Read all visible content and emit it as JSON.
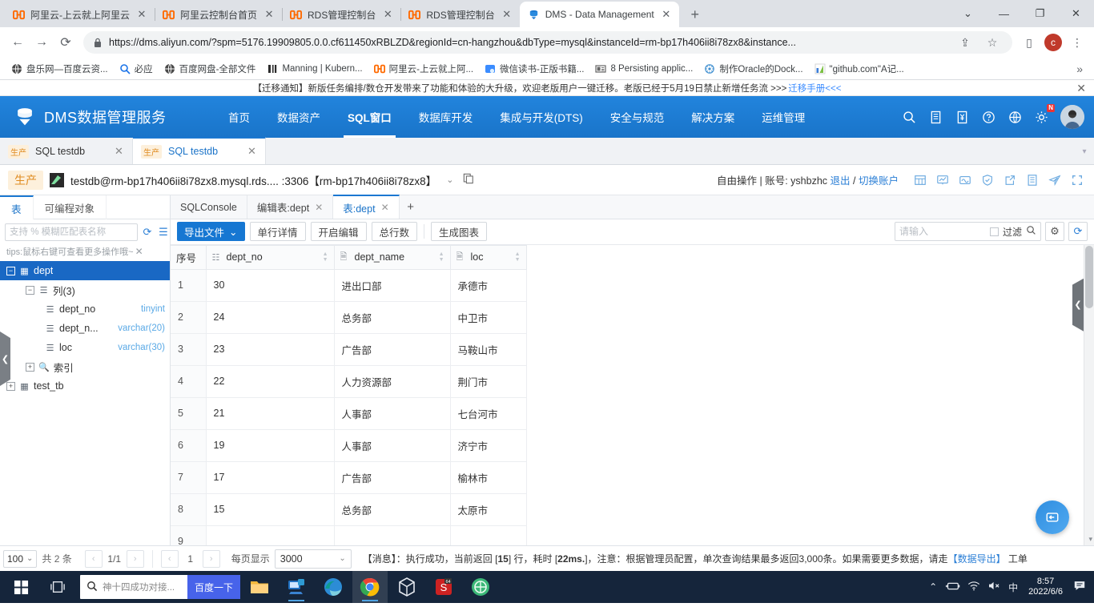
{
  "browser": {
    "tabs": [
      {
        "title": "阿里云-上云就上阿里云",
        "favicon": "aliyun-icon",
        "active": false
      },
      {
        "title": "阿里云控制台首页",
        "favicon": "aliyun-icon",
        "active": false
      },
      {
        "title": "RDS管理控制台",
        "favicon": "aliyun-icon",
        "active": false
      },
      {
        "title": "RDS管理控制台",
        "favicon": "aliyun-icon",
        "active": false
      },
      {
        "title": "DMS - Data Management",
        "favicon": "dms-icon",
        "active": true
      }
    ],
    "newtab_label": "+",
    "window_controls": {
      "minimize": "—",
      "maximize": "❐",
      "close": "✕",
      "tablist": "⌄"
    },
    "nav": {
      "back": "←",
      "forward": "→",
      "reload": "⟳"
    },
    "url": "https://dms.aliyun.com/?spm=5176.19909805.0.0.cf611450xRBLZD&regionId=cn-hangzhou&dbType=mysql&instanceId=rm-bp17h406ii8i78zx8&instance...",
    "omnibox_icons": {
      "share": "⇪",
      "bookmark": "☆",
      "sidepanel": "▯",
      "menu": "⋮"
    },
    "profile_initial": "c",
    "bookmarks": [
      {
        "label": "盘乐网—百度云资...",
        "icon": "globe-icon"
      },
      {
        "label": "必应",
        "icon": "search-icon"
      },
      {
        "label": "百度网盘-全部文件",
        "icon": "globe-icon"
      },
      {
        "label": "Manning | Kubern...",
        "icon": "manning-icon"
      },
      {
        "label": "阿里云-上云就上阿...",
        "icon": "aliyun-icon"
      },
      {
        "label": "微信读书-正版书籍...",
        "icon": "wechat-icon"
      },
      {
        "label": "8 Persisting applic...",
        "icon": "book-icon"
      },
      {
        "label": "制作Oracle的Dock...",
        "icon": "docker-icon"
      },
      {
        "label": "\"github.com\"A记...",
        "icon": "chart-icon"
      }
    ],
    "bookmarks_overflow": "»"
  },
  "notice": {
    "text": "【迁移通知】新版任务编排/数仓开发带来了功能和体验的大升级，欢迎老版用户一键迁移。老版已经于5月19日禁止新增任务流 >>>",
    "link": "迁移手册<<<",
    "close": "✕"
  },
  "dms_header": {
    "brand": "DMS数据管理服务",
    "logo_icon": "dms-logo-icon",
    "nav": [
      {
        "label": "首页",
        "selected": false
      },
      {
        "label": "数据资产",
        "selected": false
      },
      {
        "label": "SQL窗口",
        "selected": true
      },
      {
        "label": "数据库开发",
        "selected": false
      },
      {
        "label": "集成与开发(DTS)",
        "selected": false
      },
      {
        "label": "安全与规范",
        "selected": false
      },
      {
        "label": "解决方案",
        "selected": false
      },
      {
        "label": "运维管理",
        "selected": false
      }
    ],
    "icons": [
      {
        "name": "search-icon",
        "glyph": "🔍"
      },
      {
        "name": "document-icon",
        "glyph": "📋"
      },
      {
        "name": "billing-icon",
        "glyph": "¥"
      },
      {
        "name": "help-icon",
        "glyph": "?"
      },
      {
        "name": "language-icon",
        "glyph": "🌐"
      },
      {
        "name": "settings-icon",
        "glyph": "⚙"
      }
    ],
    "badge": "N",
    "avatar": "user-avatar"
  },
  "session_tabs": [
    {
      "env": "生产",
      "label": "SQL testdb",
      "close": "✕",
      "active": false
    },
    {
      "env": "生产",
      "label": "SQL testdb",
      "close": "✕",
      "active": true
    }
  ],
  "connection": {
    "env_badge": "生产",
    "db_icon": "database-icon",
    "text": "testdb@rm-bp17h406ii8i78zx8.mysql.rds.... :3306【rm-bp17h406ii8i78zx8】",
    "caret": "⌄",
    "copy_icon": "copy-icon",
    "account_prefix": "自由操作 | 账号: yshbzhc",
    "logout": "退出",
    "sep": "/",
    "switch_account": "切换账户",
    "tools": [
      {
        "name": "table-view-icon",
        "glyph": "▦"
      },
      {
        "name": "chart-icon",
        "glyph": "▨"
      },
      {
        "name": "monitor-icon",
        "glyph": "▣"
      },
      {
        "name": "shield-icon",
        "glyph": "⛉"
      },
      {
        "name": "export-icon",
        "glyph": "↗"
      },
      {
        "name": "log-icon",
        "glyph": "▤"
      },
      {
        "name": "send-icon",
        "glyph": "➤"
      },
      {
        "name": "fullscreen-icon",
        "glyph": "⤢"
      }
    ]
  },
  "left_panel": {
    "tabs": [
      {
        "label": "表",
        "selected": true
      },
      {
        "label": "可编程对象",
        "selected": false
      }
    ],
    "search_placeholder": "支持 % 模糊匹配表名称",
    "refresh_icon": "refresh-icon",
    "menu_icon": "list-menu-icon",
    "tips": "tips:鼠标右键可查看更多操作哦~",
    "tips_close": "✕",
    "tree": [
      {
        "level": 0,
        "toggle": "−",
        "icon": "table-icon",
        "label": "dept",
        "type": "",
        "selected": true
      },
      {
        "level": 1,
        "toggle": "−",
        "icon": "columns-icon",
        "label": "列(3)",
        "type": "",
        "selected": false
      },
      {
        "level": 2,
        "toggle": "",
        "icon": "column-icon",
        "label": "dept_no",
        "type": "tinyint",
        "selected": false
      },
      {
        "level": 2,
        "toggle": "",
        "icon": "column-icon",
        "label": "dept_n...",
        "type": "varchar(20)",
        "selected": false
      },
      {
        "level": 2,
        "toggle": "",
        "icon": "column-icon",
        "label": "loc",
        "type": "varchar(30)",
        "selected": false
      },
      {
        "level": 1,
        "toggle": "+",
        "icon": "index-icon",
        "label": "索引",
        "type": "",
        "selected": false
      },
      {
        "level": 0,
        "toggle": "+",
        "icon": "table-icon",
        "label": "test_tb",
        "type": "",
        "selected": false
      }
    ],
    "collapse_handle": "❮"
  },
  "result_tabs": [
    {
      "label": "SQLConsole",
      "closable": false,
      "active": false
    },
    {
      "label": "编辑表:dept",
      "closable": true,
      "active": false
    },
    {
      "label": "表:dept",
      "closable": true,
      "active": true
    }
  ],
  "result_tab_add": "+",
  "toolbar": {
    "export_label": "导出文件",
    "export_caret": "⌄",
    "row_detail_label": "单行详情",
    "start_edit_label": "开启编辑",
    "total_rows_label": "总行数",
    "make_chart_label": "生成图表",
    "filter_placeholder": "请输入",
    "filter_checkbox_label": "过滤",
    "search_icon": "search-icon",
    "settings_icon": "gear-icon",
    "refresh_icon": "refresh-icon"
  },
  "table": {
    "columns": [
      {
        "key": "idx",
        "label": "序号",
        "icon": "",
        "sortable": false
      },
      {
        "key": "dept_no",
        "label": "dept_no",
        "icon": "number-column-icon",
        "sortable": true
      },
      {
        "key": "dept_name",
        "label": "dept_name",
        "icon": "text-column-icon",
        "sortable": true
      },
      {
        "key": "loc",
        "label": "loc",
        "icon": "text-column-icon",
        "sortable": true
      }
    ],
    "rows": [
      {
        "idx": "1",
        "dept_no": "30",
        "dept_name": "进出口部",
        "loc": "承德市"
      },
      {
        "idx": "2",
        "dept_no": "24",
        "dept_name": "总务部",
        "loc": "中卫市"
      },
      {
        "idx": "3",
        "dept_no": "23",
        "dept_name": "广告部",
        "loc": "马鞍山市"
      },
      {
        "idx": "4",
        "dept_no": "22",
        "dept_name": "人力资源部",
        "loc": "荆门市"
      },
      {
        "idx": "5",
        "dept_no": "21",
        "dept_name": "人事部",
        "loc": "七台河市"
      },
      {
        "idx": "6",
        "dept_no": "19",
        "dept_name": "人事部",
        "loc": "济宁市"
      },
      {
        "idx": "7",
        "dept_no": "17",
        "dept_name": "广告部",
        "loc": "榆林市"
      },
      {
        "idx": "8",
        "dept_no": "15",
        "dept_name": "总务部",
        "loc": "太原市"
      },
      {
        "idx": "9",
        "dept_no": "",
        "dept_name": "",
        "loc": ""
      }
    ]
  },
  "statusbar": {
    "page_size": "100",
    "page_size_caret": "⌄",
    "total_text": "共 2 条",
    "prev": "‹",
    "next": "›",
    "page_indicator": "1/1",
    "page_number": "1",
    "per_page_label": "每页显示",
    "per_page_value": "3000",
    "per_page_caret": "⌄",
    "message_prefix": "【消息】：执行成功，当前返回 [",
    "message_rows": "15",
    "message_mid": "] 行，耗时 [",
    "message_time": "22ms.",
    "message_suffix": "]，注意：根据管理员配置，单次查询结果最多返回3,000条。如果需要更多数据，请走",
    "message_link": "【数据导出】",
    "message_tail": " 工单"
  },
  "floating": {
    "pull_handle": "❮",
    "fab_icon": "feedback-icon",
    "scroll_arrow": "▾"
  },
  "taskbar": {
    "start_icon": "windows-icon",
    "taskview_icon": "task-view-icon",
    "search_text": "神十四成功对接...",
    "search_button": "百度一下",
    "search_icon": "search-icon",
    "apps": [
      {
        "name": "file-explorer-icon"
      },
      {
        "name": "remote-desktop-icon"
      },
      {
        "name": "edge-icon"
      },
      {
        "name": "chrome-icon"
      },
      {
        "name": "cube-app-icon"
      },
      {
        "name": "pdf-reader-icon"
      },
      {
        "name": "green-app-icon"
      }
    ],
    "tray": [
      {
        "name": "chevron-up-icon",
        "glyph": "⌃"
      },
      {
        "name": "battery-icon",
        "glyph": "🔋"
      },
      {
        "name": "wifi-icon",
        "glyph": "📶"
      },
      {
        "name": "volume-muted-icon",
        "glyph": "🔇"
      },
      {
        "name": "ime-icon",
        "glyph": "中"
      }
    ],
    "time": "8:57",
    "date": "2022/6/6",
    "notification_icon": "notification-icon"
  },
  "colors": {
    "dms_blue": "#1b78d1",
    "accent": "#1677d2",
    "env_orange": "#e08b20",
    "tree_selected": "#1968c4",
    "taskbar": "#15253b"
  }
}
